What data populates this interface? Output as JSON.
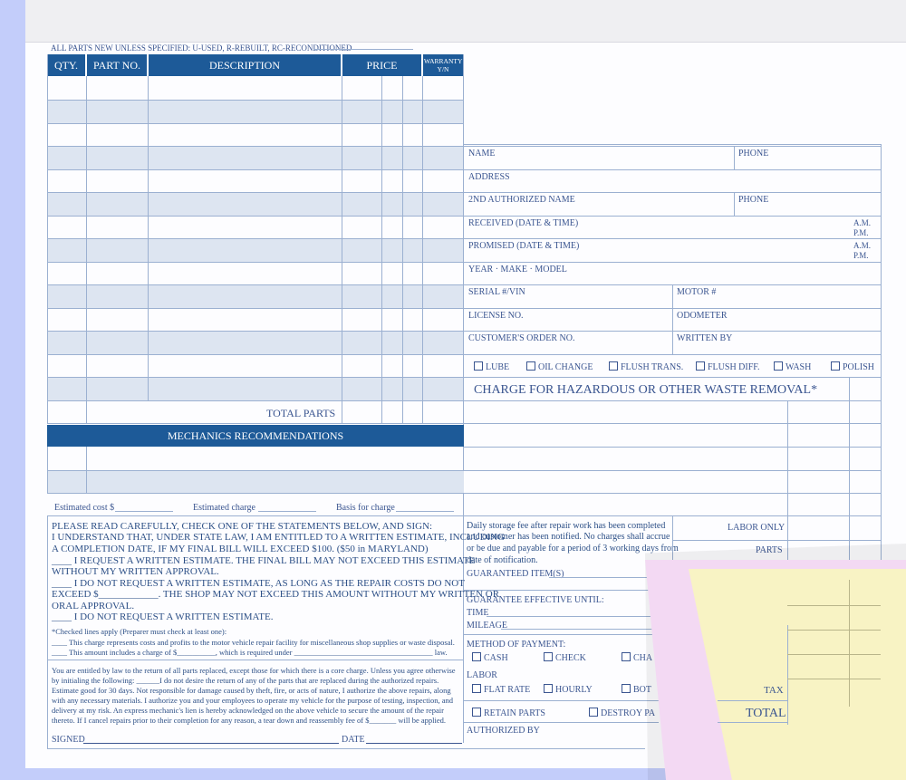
{
  "header_note": "ALL PARTS NEW UNLESS SPECIFIED: U-USED, R-REBUILT, RC-RECONDITIONED",
  "parts_table": {
    "columns": [
      "QTY.",
      "PART NO.",
      "DESCRIPTION",
      "PRICE",
      "WARRANTY Y/N"
    ],
    "total_label": "TOTAL PARTS"
  },
  "mechanics_recommendations": "MECHANICS RECOMMENDATIONS",
  "estimate_line": {
    "estimated_cost": "Estimated cost $",
    "estimated_charge": "Estimated charge",
    "basis_for_charge": "Basis for charge"
  },
  "customer_info": {
    "name": "NAME",
    "phone": "PHONE",
    "address": "ADDRESS",
    "second_name": "2ND AUTHORIZED NAME",
    "phone2": "PHONE",
    "received": "RECEIVED (DATE & TIME)",
    "promised": "PROMISED (DATE & TIME)",
    "am": "A.M.",
    "pm": "P.M.",
    "ymm": "YEAR · MAKE · MODEL",
    "serial": "SERIAL #/VIN",
    "motor": "MOTOR #",
    "license": "LICENSE NO.",
    "odometer": "ODOMETER",
    "customer_order": "CUSTOMER'S ORDER NO.",
    "written_by": "WRITTEN BY"
  },
  "services": [
    "LUBE",
    "OIL CHANGE",
    "FLUSH TRANS.",
    "FLUSH DIFF.",
    "WASH",
    "POLISH"
  ],
  "hazardous": "CHARGE FOR HAZARDOUS OR OTHER WASTE REMOVAL*",
  "statement": {
    "l1": "PLEASE READ CAREFULLY, CHECK ONE OF THE STATEMENTS BELOW, AND SIGN:",
    "l2": "I UNDERSTAND THAT, UNDER STATE LAW, I AM ENTITLED TO A WRITTEN ESTIMATE, INCLUDING",
    "l3": "A COMPLETION DATE, IF MY FINAL BILL WILL EXCEED $100. ($50 in MARYLAND)",
    "l4": "____ I REQUEST A WRITTEN ESTIMATE. THE FINAL BILL MAY NOT EXCEED THIS ESTIMATE",
    "l5": "WITHOUT MY WRITTEN APPROVAL.",
    "l6": "____ I DO NOT REQUEST A WRITTEN ESTIMATE, AS LONG AS THE REPAIR COSTS DO NOT",
    "l7": "EXCEED $____________. THE SHOP MAY NOT EXCEED THIS AMOUNT WITHOUT MY WRITTEN OR",
    "l8": "ORAL APPROVAL.",
    "l9": "____ I DO NOT REQUEST A WRITTEN ESTIMATE."
  },
  "checked_lines": {
    "l1": "*Checked lines apply (Preparer must check at least one):",
    "l2": "____ This charge represents costs and profits to the motor vehicle repair facility for miscellaneous shop supplies or waste disposal.",
    "l3": "____ This amount includes a charge of $__________, which is required under ____________________________________ law."
  },
  "legal": {
    "l1": "You are entitled by law to the return of all parts replaced, except those for which there is a core charge. Unless you agree otherwise",
    "l2": "by initialing the following: ______I do not desire the return of any of the parts that are replaced during the authorized repairs.",
    "l3": "Estimate good for 30 days. Not responsible for damage caused by theft, fire, or acts of nature, I authorize the above repairs, along",
    "l4": "with any necessary materials. I authorize you and your employees to operate my vehicle for the purpose of testing, inspection, and",
    "l5": "delivery at my risk. An express mechanic's lien is hereby acknowledged on the above vehicle to secure the amount of the repair",
    "l6": "thereto. If I cancel repairs prior to their completion for any reason, a tear down and reassembly fee of $_______ will be applied."
  },
  "signed": "SIGNED",
  "date": "DATE",
  "storage": {
    "l1": "Daily storage fee after repair work has been completed",
    "l2": "and customer has been notified. No charges shall accrue",
    "l3": "or be due and payable for a period of 3 working days from",
    "l4": "date of notification."
  },
  "guaranteed": "GUARANTEED ITEM(S)",
  "guarantee_until": "GUARANTEE EFFECTIVE UNTIL:",
  "time": "TIME",
  "mileage": "MILEAGE",
  "method": "METHOD OF PAYMENT:",
  "payments": [
    "CASH",
    "CHECK",
    "CHA"
  ],
  "labor": "LABOR",
  "labor_options": [
    "FLAT RATE",
    "HOURLY",
    "BOT"
  ],
  "parts_options": [
    "RETAIN PARTS",
    "DESTROY PA"
  ],
  "authorized": "AUTHORIZED BY",
  "totals": {
    "labor_only": "LABOR ONLY",
    "parts": "PARTS",
    "tax": "TAX",
    "total": "TOTAL"
  }
}
